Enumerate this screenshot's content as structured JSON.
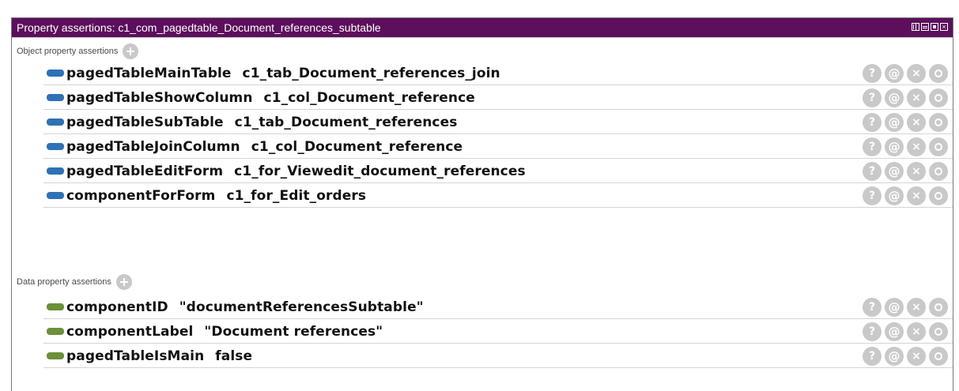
{
  "window": {
    "title": "Property assertions: c1_com_pagedtable_Document_references_subtable",
    "close_glyph": "×"
  },
  "object_section": {
    "label": "Object property assertions",
    "rows": [
      {
        "property": "pagedTableMainTable",
        "value": "c1_tab_Document_references_join"
      },
      {
        "property": "pagedTableShowColumn",
        "value": "c1_col_Document_reference"
      },
      {
        "property": "pagedTableSubTable",
        "value": "c1_tab_Document_references"
      },
      {
        "property": "pagedTableJoinColumn",
        "value": "c1_col_Document_reference"
      },
      {
        "property": "pagedTableEditForm",
        "value": "c1_for_Viewedit_document_references"
      },
      {
        "property": "componentForForm",
        "value": "c1_for_Edit_orders"
      }
    ]
  },
  "data_section": {
    "label": "Data property assertions",
    "rows": [
      {
        "property": "componentID",
        "value": "\"documentReferencesSubtable\""
      },
      {
        "property": "componentLabel",
        "value": "\"Document references\""
      },
      {
        "property": "pagedTableIsMain",
        "value": "false"
      }
    ]
  },
  "row_buttons": {
    "explain": "?",
    "annotate": "@",
    "delete": "×"
  },
  "colors": {
    "title_bar": "#5c0f5c",
    "object_marker": "#2f71b5",
    "data_marker": "#6b8f3a",
    "button_gray": "#c9c9c9"
  }
}
